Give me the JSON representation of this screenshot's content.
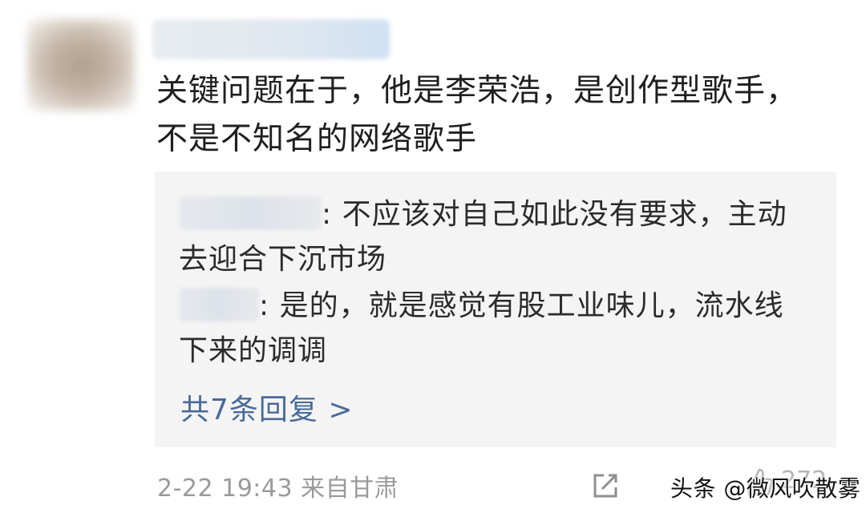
{
  "comment": {
    "text_line1": "关键问题在于，他是李荣浩，是创作型歌手，",
    "text_line2": "不是不知名的网络歌手"
  },
  "replies": [
    {
      "text": ": 不应该对自己如此没有要求，主动去迎合下沉市场"
    },
    {
      "text": ": 是的，就是感觉有股工业味儿，流水线下来的调调"
    }
  ],
  "reply_count_label": "共7条回复 >",
  "meta": {
    "timestamp": "2-22 19:43",
    "location": "来自甘肃"
  },
  "like_count": "272",
  "icons": {
    "share": "share-icon",
    "like": "like-icon"
  },
  "watermark": "头条 @微风吹散雾",
  "colors": {
    "reply_link": "#4a6a98",
    "meta_text": "#9a9a9a",
    "reply_bg": "#f4f4f5"
  }
}
